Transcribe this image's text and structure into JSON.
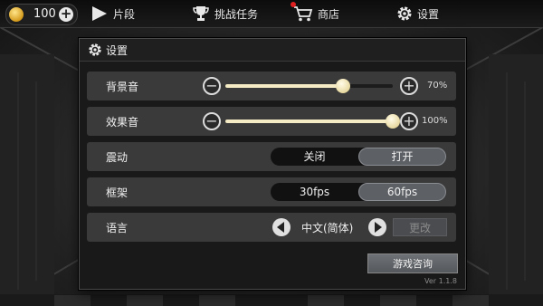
{
  "topbar": {
    "coins": "100",
    "nav": [
      {
        "label": "片段",
        "icon": "play-icon"
      },
      {
        "label": "挑战任务",
        "icon": "trophy-icon"
      },
      {
        "label": "商店",
        "icon": "cart-icon",
        "has_notification": true
      },
      {
        "label": "设置",
        "icon": "gear-icon"
      }
    ]
  },
  "panel": {
    "title": "设置",
    "bgm": {
      "label": "背景音",
      "value": 0.7,
      "display": "70%"
    },
    "sfx": {
      "label": "效果音",
      "value": 1.0,
      "display": "100%"
    },
    "vibration": {
      "label": "震动",
      "options": [
        "关闭",
        "打开"
      ],
      "selected": 1
    },
    "framerate": {
      "label": "框架",
      "options": [
        "30fps",
        "60fps"
      ],
      "selected": 1
    },
    "language": {
      "label": "语言",
      "value": "中文(简体)",
      "change_label": "更改"
    },
    "consult_label": "游戏咨询",
    "version": "Ver 1.1.8"
  },
  "colors": {
    "slider_fill": "#f5ecc6",
    "notification": "#e02020",
    "coin": "#d49a1b"
  }
}
